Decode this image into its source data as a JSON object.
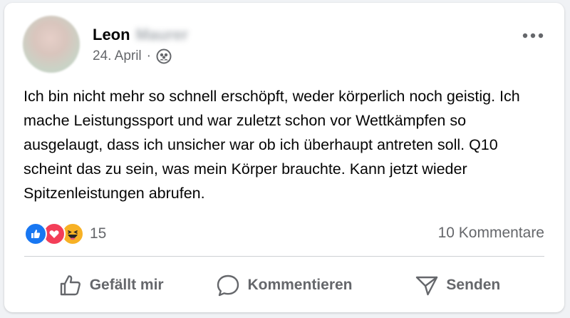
{
  "post": {
    "author": {
      "first_name": "Leon",
      "surname": "Maurer"
    },
    "date": "24. April",
    "separator": "·",
    "audience_icon": "friends-icon",
    "text": "Ich bin nicht mehr so schnell erschöpft, weder körperlich noch geistig. Ich mache Leistungssport und war zuletzt schon vor Wettkämpfen so ausgelaugt, dass ich unsicher war ob ich überhaupt antreten soll. Q10 scheint das zu sein, was mein Körper brauchte. Kann jetzt wieder Spitzenleistungen abrufen."
  },
  "reactions": {
    "types": [
      "like",
      "love",
      "haha"
    ],
    "count": "15",
    "comments_label": "10 Kommentare"
  },
  "actions": {
    "like_label": "Gefällt mir",
    "comment_label": "Kommentieren",
    "share_label": "Senden"
  },
  "colors": {
    "like": "#1877f2",
    "love": "#f33e58",
    "haha": "#f7b125",
    "secondary_text": "#65676b",
    "primary_text": "#050505"
  }
}
